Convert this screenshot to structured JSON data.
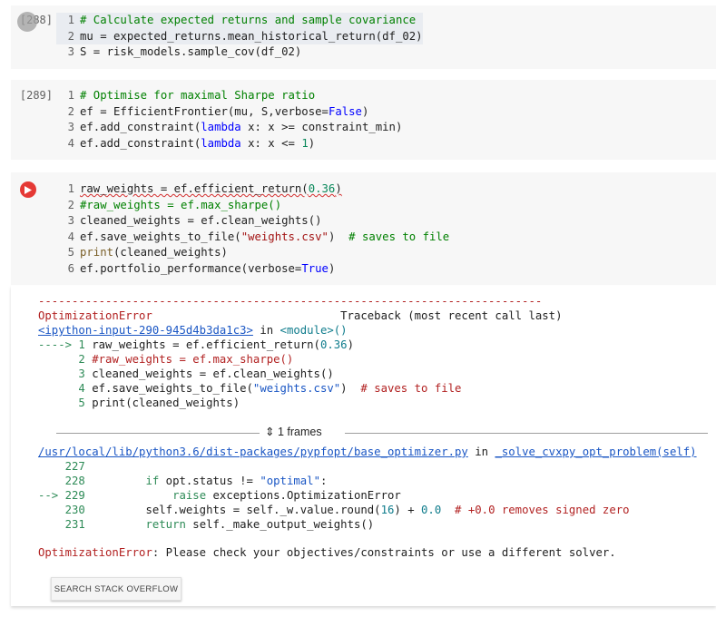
{
  "cells": [
    {
      "prompt": "[288]",
      "lines": [
        "# Calculate expected returns and sample covariance",
        "mu = expected_returns.mean_historical_return(df_02)",
        "S = risk_models.sample_cov(df_02)"
      ]
    },
    {
      "prompt": "[289]",
      "lines": [
        "# Optimise for maximal Sharpe ratio",
        "ef = EfficientFrontier(mu, S,verbose=False)",
        "ef.add_constraint(lambda x: x >= constraint_min)",
        "ef.add_constraint(lambda x: x <= 1)"
      ]
    },
    {
      "prompt": "",
      "lines": [
        "raw_weights = ef.efficient_return(0.36)",
        "#raw_weights = ef.max_sharpe()",
        "cleaned_weights = ef.clean_weights()",
        "ef.save_weights_to_file(\"weights.csv\")  # saves to file",
        "print(cleaned_weights)",
        "ef.portfolio_performance(verbose=True)"
      ]
    }
  ],
  "output": {
    "dashes": "---------------------------------------------------------------------------",
    "error_name": "OptimizationError",
    "traceback_label": "Traceback (most recent call last)",
    "input_link": "<ipython-input-290-945d4b3da1c3>",
    "in_text": " in ",
    "module_text": "<module>()",
    "arrow1": "----> 1 ",
    "tb_lines": [
      "raw_weights = ef.efficient_return(0.36)",
      "#raw_weights = ef.max_sharpe()",
      "cleaned_weights = ef.clean_weights()",
      "ef.save_weights_to_file(\"weights.csv\")  # saves to file",
      "print(cleaned_weights)"
    ],
    "frames_label": "1 frames",
    "file_link": "/usr/local/lib/python3.6/dist-packages/pypfopt/base_optimizer.py",
    "func_name": "_solve_cvxpy_opt_problem(self)",
    "src_lines": [
      {
        "no": "227",
        "code": ""
      },
      {
        "no": "228",
        "code": "        if opt.status != \"optimal\":"
      },
      {
        "no": "229",
        "code": "            raise exceptions.OptimizationError",
        "arrow": "--> "
      },
      {
        "no": "230",
        "code": "        self.weights = self._w.value.round(16) + 0.0  # +0.0 removes signed zero"
      },
      {
        "no": "231",
        "code": "        return self._make_output_weights()"
      }
    ],
    "final_error": "OptimizationError",
    "final_message": ": Please check your objectives/constraints or use a different solver."
  },
  "search_button": "SEARCH STACK OVERFLOW"
}
